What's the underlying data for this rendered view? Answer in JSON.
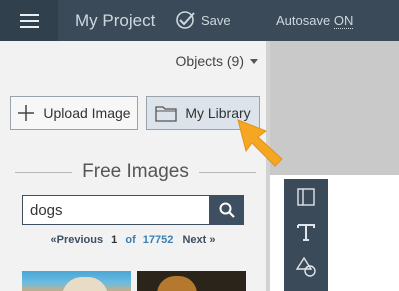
{
  "header": {
    "project_title": "My Project",
    "save_label": "Save",
    "autosave_label": "Autosave",
    "autosave_state": "ON"
  },
  "sidebar": {
    "objects_label": "Objects (9)",
    "upload_label": "Upload Image",
    "library_label": "My Library",
    "free_images_title": "Free Images",
    "search": {
      "value": "dogs",
      "placeholder": "dogs"
    },
    "pager": {
      "previous_label": "«Previous",
      "current_page": "1",
      "of_label": "of",
      "total_pages": "17752",
      "next_label": "Next »"
    }
  },
  "tools": [
    {
      "icon": "layout-icon"
    },
    {
      "icon": "text-icon"
    },
    {
      "icon": "shapes-icon"
    }
  ],
  "colors": {
    "header_bg": "#3b4a58",
    "sidebar_bg": "#f2f2f2",
    "accent_arrow": "#f5a623",
    "search_button": "#3d4f60",
    "link_blue": "#3a7fb5"
  }
}
